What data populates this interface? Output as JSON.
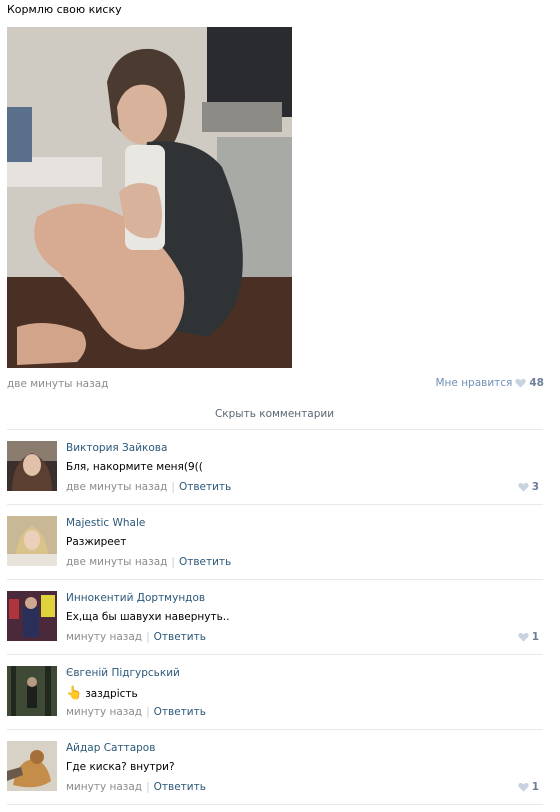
{
  "post": {
    "text": "Кормлю свою киску",
    "time": "две минуты назад",
    "like_label": "Мне нравится",
    "like_count": "48"
  },
  "hide_comments_label": "Скрыть комментарии",
  "reply_label": "Ответить",
  "comments": [
    {
      "author": "Виктория Зайкова",
      "text": "Бля, накормите меня(9((",
      "time": "две минуты назад",
      "likes": "3"
    },
    {
      "author": "Majestic Whale",
      "text": "Разжиреет",
      "time": "две минуты назад",
      "likes": ""
    },
    {
      "author": "Иннокентий Дортмундов",
      "text": "Ех,ща бы шавухи навернуть..",
      "time": "минуту назад",
      "likes": "1"
    },
    {
      "author": "Євгеній Підгурський",
      "icon": "pointing-hand-icon",
      "text": "заздрість",
      "time": "минуту назад",
      "likes": ""
    },
    {
      "author": "Айдар Саттаров",
      "text": "Где киска? внутри?",
      "time": "минуту назад",
      "likes": "1"
    }
  ],
  "colors": {
    "link": "#2b587a",
    "muted": "#8c8c8c",
    "like_heart": "#c8d3df",
    "separator": "#e7eaed"
  }
}
